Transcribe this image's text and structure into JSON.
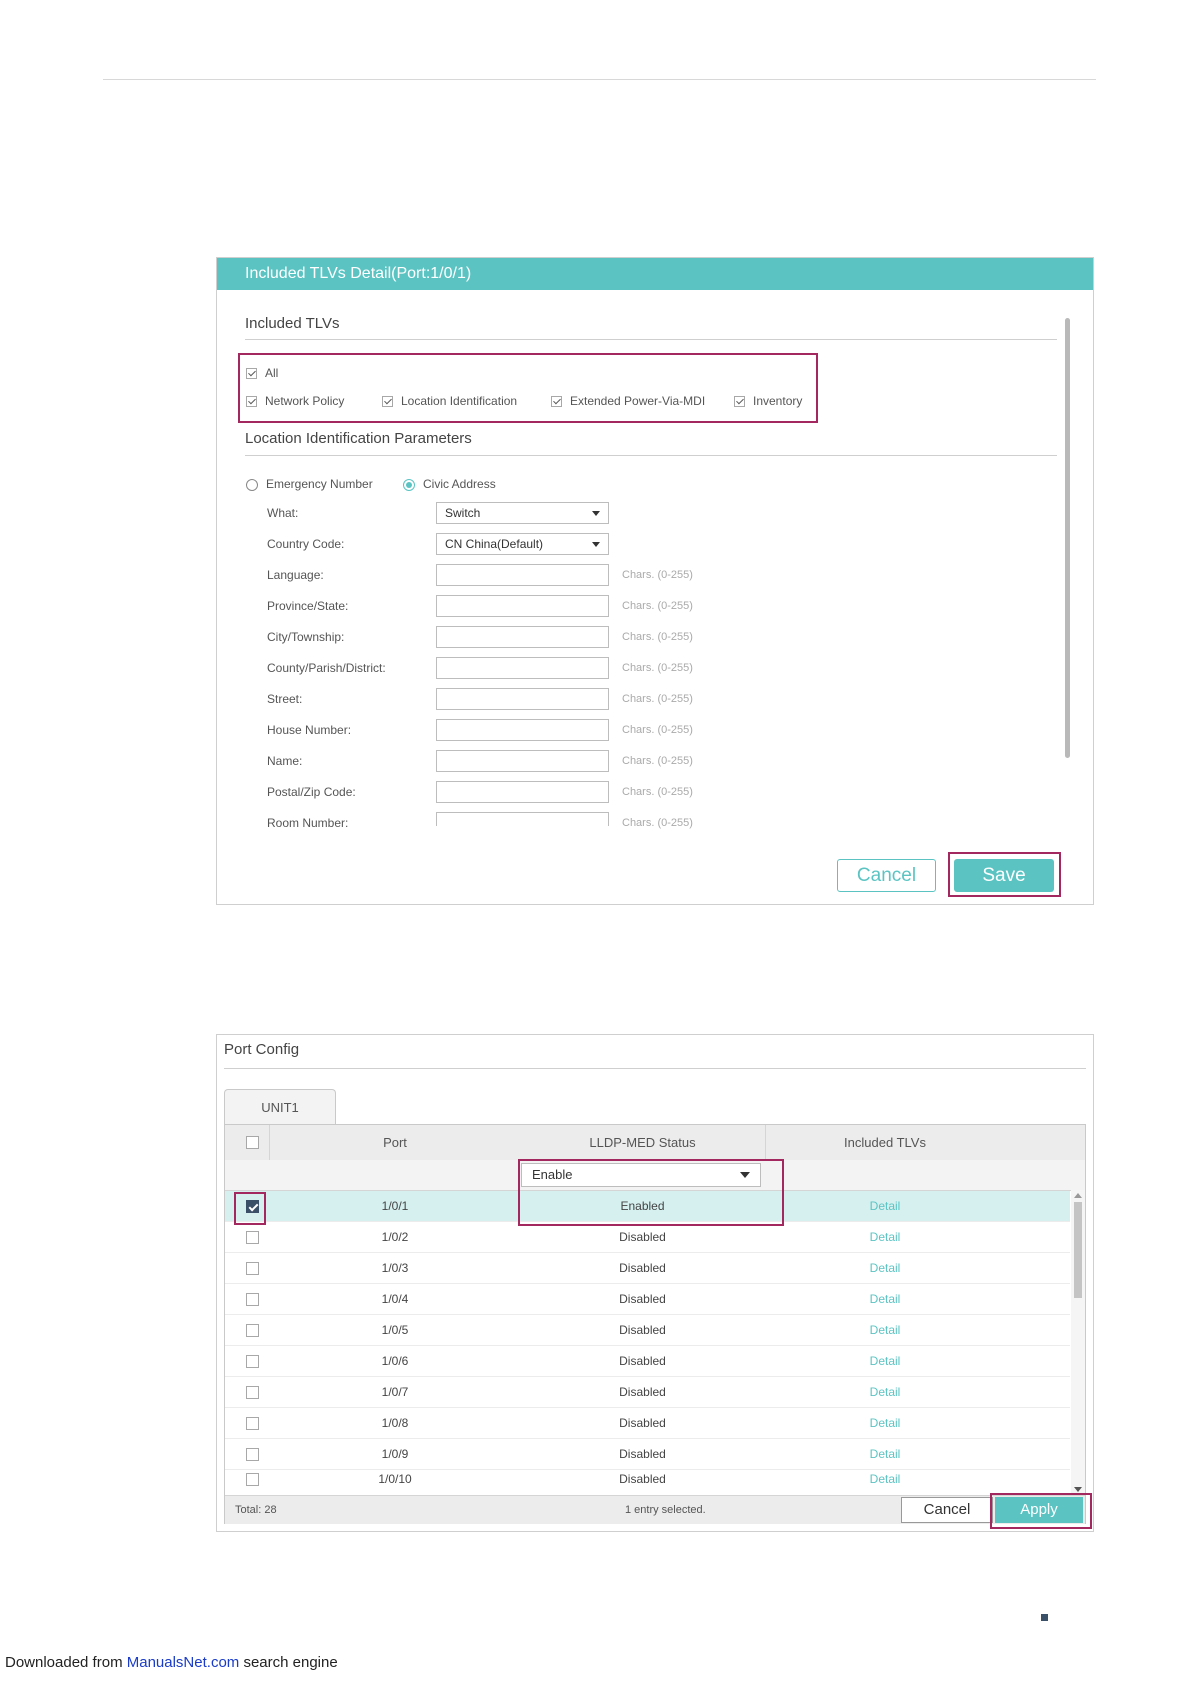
{
  "dialog": {
    "title": "Included TLVs Detail(Port:1/0/1)",
    "included_tlvs": {
      "section_title": "Included TLVs",
      "all": {
        "label": "All",
        "checked": true
      },
      "items": [
        {
          "label": "Network Policy",
          "checked": true
        },
        {
          "label": "Location Identification",
          "checked": true
        },
        {
          "label": "Extended Power-Via-MDI",
          "checked": true
        },
        {
          "label": "Inventory",
          "checked": true
        }
      ]
    },
    "location": {
      "section_title": "Location Identification Parameters",
      "modes": [
        {
          "label": "Emergency Number",
          "selected": false
        },
        {
          "label": "Civic Address",
          "selected": true
        }
      ],
      "what": {
        "label": "What:",
        "value": "Switch"
      },
      "country_code": {
        "label": "Country Code:",
        "value": "CN China(Default)"
      },
      "fields": [
        {
          "label": "Language:",
          "value": "",
          "hint": "Chars. (0-255)"
        },
        {
          "label": "Province/State:",
          "value": "",
          "hint": "Chars. (0-255)"
        },
        {
          "label": "City/Township:",
          "value": "",
          "hint": "Chars. (0-255)"
        },
        {
          "label": "County/Parish/District:",
          "value": "",
          "hint": "Chars. (0-255)"
        },
        {
          "label": "Street:",
          "value": "",
          "hint": "Chars. (0-255)"
        },
        {
          "label": "House Number:",
          "value": "",
          "hint": "Chars. (0-255)"
        },
        {
          "label": "Name:",
          "value": "",
          "hint": "Chars. (0-255)"
        },
        {
          "label": "Postal/Zip Code:",
          "value": "",
          "hint": "Chars. (0-255)"
        },
        {
          "label": "Room Number:",
          "value": "",
          "hint": "Chars. (0-255)"
        }
      ]
    },
    "cancel_label": "Cancel",
    "save_label": "Save"
  },
  "port_config": {
    "title": "Port Config",
    "tab_label": "UNIT1",
    "columns": {
      "port": "Port",
      "status": "LLDP-MED Status",
      "tlvs": "Included TLVs"
    },
    "filter_value": "Enable",
    "rows": [
      {
        "port": "1/0/1",
        "status": "Enabled",
        "tlvs": "Detail",
        "checked": true
      },
      {
        "port": "1/0/2",
        "status": "Disabled",
        "tlvs": "Detail",
        "checked": false
      },
      {
        "port": "1/0/3",
        "status": "Disabled",
        "tlvs": "Detail",
        "checked": false
      },
      {
        "port": "1/0/4",
        "status": "Disabled",
        "tlvs": "Detail",
        "checked": false
      },
      {
        "port": "1/0/5",
        "status": "Disabled",
        "tlvs": "Detail",
        "checked": false
      },
      {
        "port": "1/0/6",
        "status": "Disabled",
        "tlvs": "Detail",
        "checked": false
      },
      {
        "port": "1/0/7",
        "status": "Disabled",
        "tlvs": "Detail",
        "checked": false
      },
      {
        "port": "1/0/8",
        "status": "Disabled",
        "tlvs": "Detail",
        "checked": false
      },
      {
        "port": "1/0/9",
        "status": "Disabled",
        "tlvs": "Detail",
        "checked": false
      },
      {
        "port": "1/0/10",
        "status": "Disabled",
        "tlvs": "Detail",
        "checked": false
      }
    ],
    "total": "Total: 28",
    "selected_info": "1 entry selected.",
    "cancel_label": "Cancel",
    "apply_label": "Apply"
  },
  "footer": {
    "prefix": "Downloaded from ",
    "site": "ManualsNet.com",
    "suffix": " search engine"
  },
  "colors": {
    "accent": "#5bc4c3",
    "highlight": "#a3285f",
    "link": "#1a3cc8"
  }
}
